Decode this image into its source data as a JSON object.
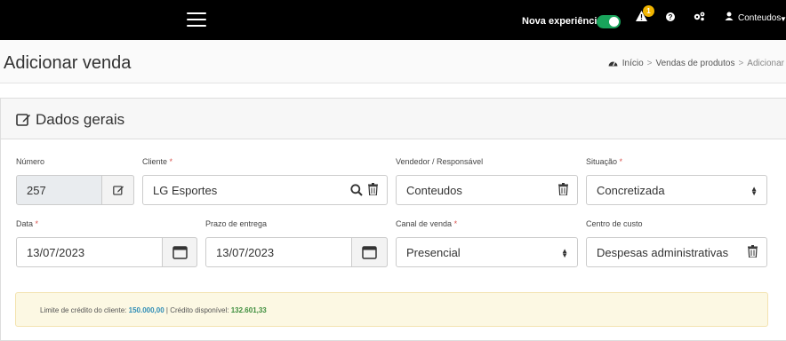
{
  "topbar": {
    "nova_label": "Nova experiência",
    "notification_count": "1",
    "user_name": "Conteudos"
  },
  "header": {
    "title": "Adicionar venda",
    "breadcrumb": {
      "home": "Início",
      "section": "Vendas de produtos",
      "current": "Adicionar"
    }
  },
  "card": {
    "title": "Dados gerais"
  },
  "form": {
    "numero": {
      "label": "Número",
      "value": "257"
    },
    "cliente": {
      "label": "Cliente",
      "required": "*",
      "value": "LG Esportes"
    },
    "vendedor": {
      "label": "Vendedor / Responsável",
      "value": "Conteudos"
    },
    "situacao": {
      "label": "Situação",
      "required": "*",
      "value": "Concretizada"
    },
    "data": {
      "label": "Data",
      "required": "*",
      "value": "13/07/2023"
    },
    "prazo": {
      "label": "Prazo de entrega",
      "value": "13/07/2023"
    },
    "canal": {
      "label": "Canal de venda",
      "required": "*",
      "value": "Presencial"
    },
    "centro": {
      "label": "Centro de custo",
      "value": "Despesas administrativas"
    }
  },
  "credit": {
    "limit_label": "Limite de crédito do cliente:",
    "limit_value": "150.000,00",
    "separator": "|",
    "available_label": "Crédito disponível:",
    "available_value": "132.601,33"
  }
}
